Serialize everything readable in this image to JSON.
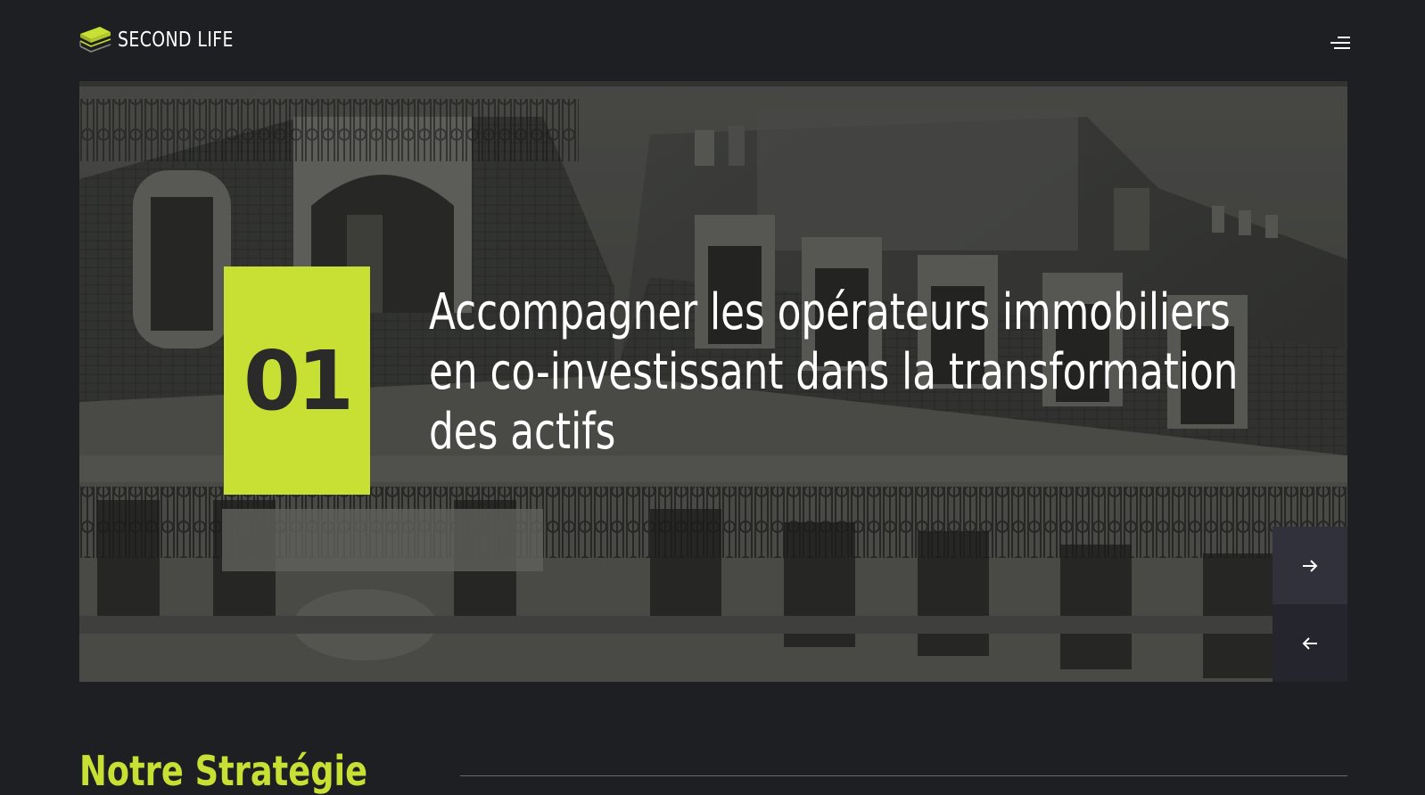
{
  "header": {
    "brand": "SECOND LIFE",
    "logo_icon": "stacked-layers-logo-icon",
    "menu_icon": "hamburger-menu-icon"
  },
  "hero": {
    "slide_number": "01",
    "headline": "Accompagner les opérateurs immobiliers en co-investissant dans la transformation des actifs",
    "next_icon": "arrow-right-icon",
    "prev_icon": "arrow-left-icon"
  },
  "strategy": {
    "title": "Notre Stratégie"
  },
  "colors": {
    "accent": "#c8df34",
    "background": "#1e1f22",
    "nav_next_bg": "#30313a",
    "nav_prev_bg": "#24252d"
  }
}
